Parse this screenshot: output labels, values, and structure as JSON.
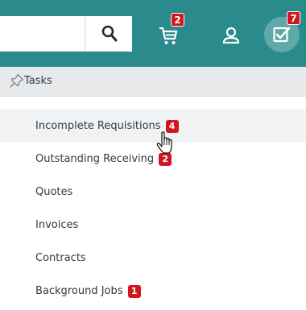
{
  "search": {
    "value": "",
    "placeholder": ""
  },
  "toolbar": {
    "cart_count": "2",
    "tasks_count": "7"
  },
  "tasks_panel": {
    "title": "Tasks",
    "items": [
      {
        "label": "Incomplete Requisitions",
        "badge": "4"
      },
      {
        "label": "Outstanding Receiving",
        "badge": "2"
      },
      {
        "label": "Quotes",
        "badge": ""
      },
      {
        "label": "Invoices",
        "badge": ""
      },
      {
        "label": "Contracts",
        "badge": ""
      },
      {
        "label": "Background Jobs",
        "badge": "1"
      }
    ]
  },
  "colors": {
    "header": "#2b8a8c",
    "badge": "#d1161d",
    "section_bg": "#e8e9ea"
  },
  "icons": [
    "search-icon",
    "cart-icon",
    "user-icon",
    "tasks-checkbox-icon",
    "pin-icon",
    "hand-cursor-icon"
  ]
}
